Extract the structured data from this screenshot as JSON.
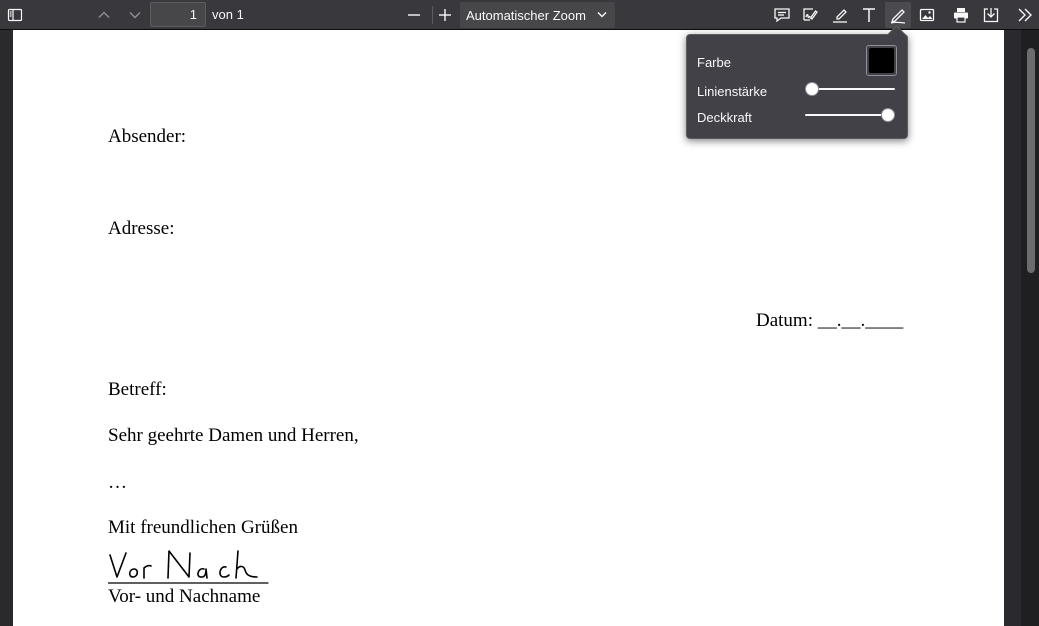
{
  "toolbar": {
    "page_number": "1",
    "page_count": "von 1",
    "zoom": "Automatischer Zoom"
  },
  "editor_ink": {
    "color_label": "Farbe",
    "color_value": "#000000",
    "thickness_label": "Linienstärke",
    "thickness_fraction": 0.0,
    "opacity_label": "Deckkraft",
    "opacity_fraction": 1.0
  },
  "document": {
    "sender": "Absender:",
    "address": "Adresse:",
    "date": "Datum: __.__.____",
    "subject": "Betreff:",
    "greeting": "Sehr geehrte Damen und Herren,",
    "body": "…",
    "closing": "Mit freundlichen Grüßen",
    "signature_caption": "Vor- und Nachname"
  },
  "icons": [
    "sidebar-toggle-icon",
    "previous-page-icon",
    "next-page-icon",
    "zoom-out-icon",
    "zoom-in-icon",
    "chevron-down-icon",
    "comment-icon",
    "signature-icon",
    "highlight-icon",
    "text-icon",
    "ink-pen-icon",
    "image-icon",
    "print-icon",
    "download-icon",
    "tools-icon"
  ]
}
